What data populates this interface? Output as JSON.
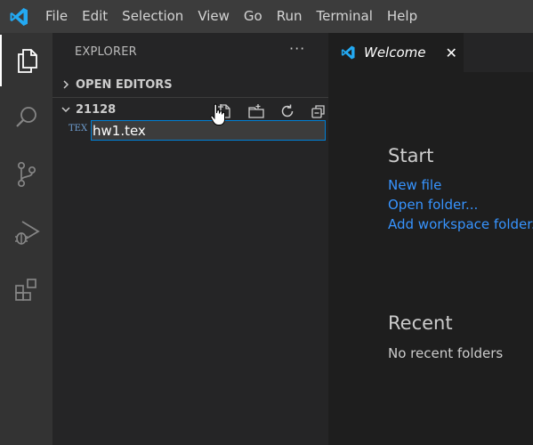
{
  "menubar": {
    "logo_icon": "vscode-logo-icon",
    "items": [
      "File",
      "Edit",
      "Selection",
      "View",
      "Go",
      "Run",
      "Terminal",
      "Help"
    ]
  },
  "activitybar": {
    "items": [
      "explorer-icon",
      "search-icon",
      "source-control-icon",
      "run-debug-icon",
      "extensions-icon"
    ],
    "active": "explorer-icon"
  },
  "sidebar": {
    "title": "EXPLORER",
    "more": "···",
    "open_editors": "OPEN EDITORS",
    "folder": "21128",
    "folder_actions": [
      "new-file-icon",
      "new-folder-icon",
      "refresh-icon",
      "collapse-all-icon"
    ],
    "new_file_icon_text": "TEX",
    "rename_value": "hw1.tex"
  },
  "editor": {
    "tab_label": "Welcome",
    "tab_close": "✕"
  },
  "welcome": {
    "start_title": "Start",
    "links": [
      "New file",
      "Open folder...",
      "Add workspace folder..."
    ],
    "recent_title": "Recent",
    "no_recent": "No recent folders"
  },
  "colors": {
    "accent": "#007fd4",
    "link": "#3794ff",
    "vscode_blue": "#23a9f2"
  }
}
